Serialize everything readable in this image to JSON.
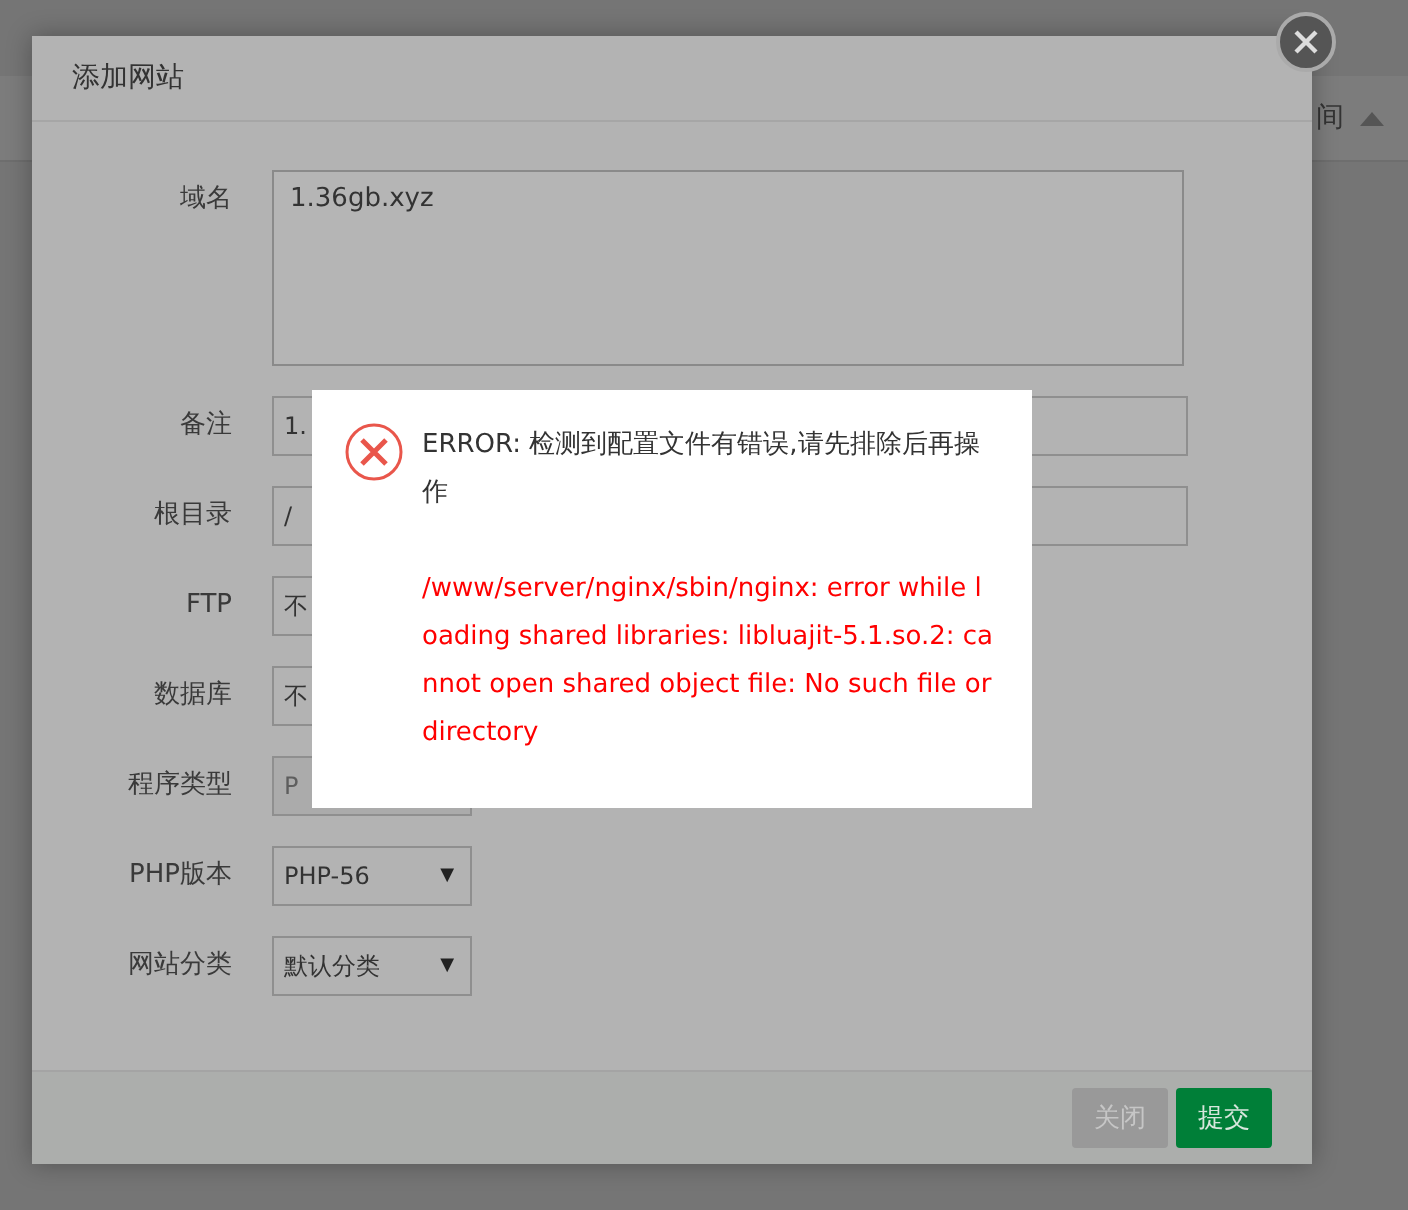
{
  "background": {
    "column_heading": "间"
  },
  "dialog": {
    "title": "添加网站",
    "fields": [
      {
        "label": "域名",
        "kind": "textarea",
        "value": "1.36gb.xyz"
      },
      {
        "label": "备注",
        "kind": "input",
        "value": "1."
      },
      {
        "label": "根目录",
        "kind": "input",
        "value": "/"
      },
      {
        "label": "FTP",
        "kind": "select",
        "value": "不"
      },
      {
        "label": "数据库",
        "kind": "select",
        "value": "不"
      },
      {
        "label": "程序类型",
        "kind": "disabled",
        "value": "P"
      },
      {
        "label": "PHP版本",
        "kind": "select",
        "value": "PHP-56",
        "caret": "▼"
      },
      {
        "label": "网站分类",
        "kind": "select",
        "value": "默认分类",
        "caret": "▼"
      }
    ],
    "buttons": [
      {
        "label": "关闭",
        "kind": "secondary"
      },
      {
        "label": "提交",
        "kind": "primary"
      }
    ]
  },
  "error": {
    "title": "ERROR: 检测到配置文件有错误,请先排除后再操作",
    "detail": "/www/server/nginx/sbin/nginx: error while loading shared libraries: libluajit-5.1.so.2: cannot open shared object file: No such file or directory"
  }
}
